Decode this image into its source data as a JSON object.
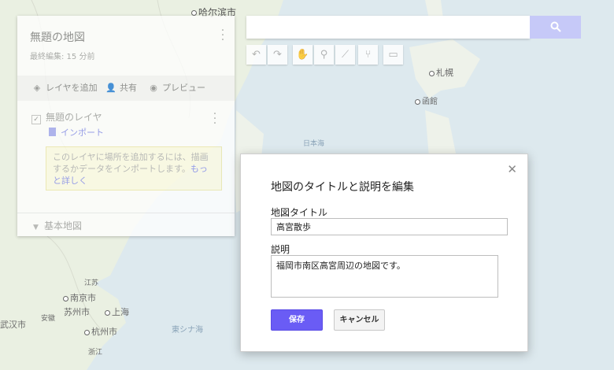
{
  "map": {
    "labels": {
      "harbin": "哈尔滨市",
      "sapporo": "札幌",
      "hakodate": "函館",
      "sea_of_japan": "日本海",
      "jiangsu": "江苏",
      "nanjing": "南京市",
      "suzhou": "苏州市",
      "shanghai": "上海",
      "anhui": "安徽",
      "wuhan": "武汉市",
      "hangzhou": "杭州市",
      "east_china_sea": "東シナ海",
      "zhejiang": "浙江"
    }
  },
  "panel": {
    "title": "無題の地図",
    "subtitle": "最終編集: 15 分前",
    "add_layer": "レイヤを追加",
    "share": "共有",
    "preview": "プレビュー",
    "layer_name": "無題のレイヤ",
    "import": "インポート",
    "hint_text": "このレイヤに場所を追加するには、描画するかデータをインポートします。",
    "hint_link": "もっと詳しく",
    "basemap": "基本地図"
  },
  "dialog": {
    "title": "地図のタイトルと説明を編集",
    "title_label": "地図タイトル",
    "title_value": "高宮散歩",
    "desc_label": "説明",
    "desc_value": "福岡市南区高宮周辺の地図です。",
    "save": "保存",
    "cancel": "キャンセル"
  },
  "colors": {
    "accent": "#6a5cf5",
    "link": "#7f86e8",
    "search_button": "#c6c9f8"
  }
}
